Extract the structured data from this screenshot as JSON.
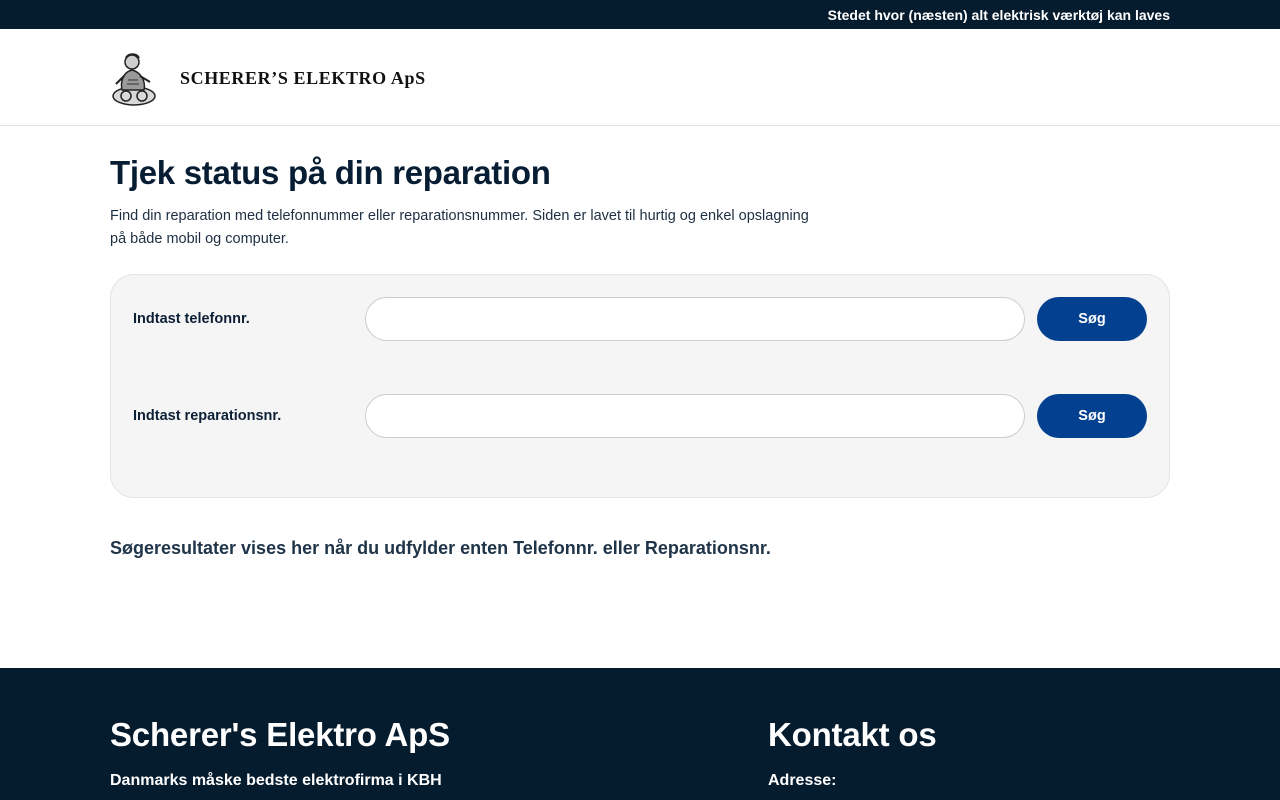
{
  "topbar": {
    "tagline": "Stedet hvor (næsten) alt elektrisk værktøj kan laves"
  },
  "header": {
    "logo_text": "SCHERER’S ELEKTRO ApS",
    "logo_emblem_icon": "craftsman-emblem-icon"
  },
  "main": {
    "title": "Tjek status på din reparation",
    "intro": "Find din reparation med telefonnummer eller reparationsnummer. Siden er lavet til hurtig og enkel opslagning på både mobil og computer.",
    "search": {
      "phone": {
        "label": "Indtast telefonnr.",
        "value": "",
        "placeholder": "",
        "button_label": "Søg"
      },
      "repair": {
        "label": "Indtast reparationsnr.",
        "value": "",
        "placeholder": "",
        "button_label": "Søg"
      }
    },
    "results_hint": "Søgeresultater vises her når du udfylder enten Telefonnr. eller Reparationsnr."
  },
  "footer": {
    "company": {
      "heading": "Scherer's Elektro ApS",
      "subheading": "Danmarks måske bedste elektrofirma i KBH"
    },
    "contact": {
      "heading": "Kontakt os",
      "address_label": "Adresse:"
    }
  },
  "colors": {
    "navy": "#051b2e",
    "button_blue": "#03408f",
    "panel_bg": "#f5f5f6"
  }
}
